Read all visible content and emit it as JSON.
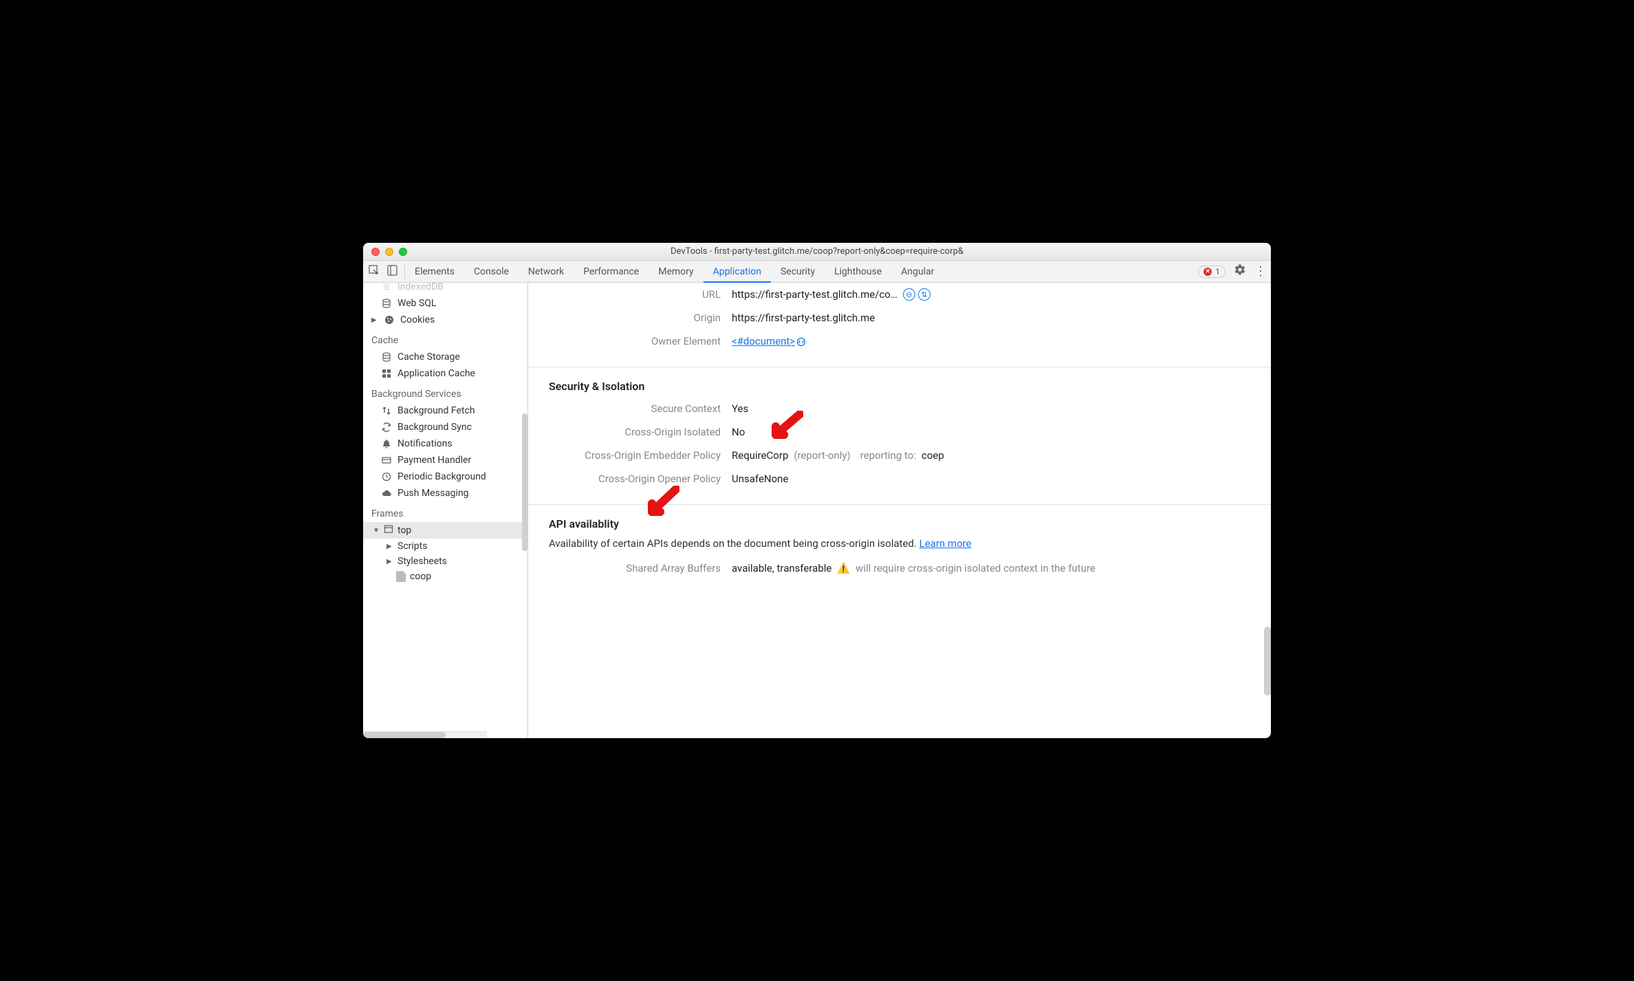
{
  "window": {
    "title": "DevTools - first-party-test.glitch.me/coop?report-only&coep=require-corp&"
  },
  "tabs": {
    "items": [
      "Elements",
      "Console",
      "Network",
      "Performance",
      "Memory",
      "Application",
      "Security",
      "Lighthouse",
      "Angular"
    ],
    "active": "Application",
    "error_count": "1"
  },
  "sidebar": {
    "indexeddb": "IndexedDB",
    "websql": "Web SQL",
    "cookies": "Cookies",
    "cache_label": "Cache",
    "cache_storage": "Cache Storage",
    "app_cache": "Application Cache",
    "bg_label": "Background Services",
    "bg_fetch": "Background Fetch",
    "bg_sync": "Background Sync",
    "notifications": "Notifications",
    "payment": "Payment Handler",
    "periodic": "Periodic Background",
    "push": "Push Messaging",
    "frames_label": "Frames",
    "top": "top",
    "scripts": "Scripts",
    "stylesheets": "Stylesheets",
    "coop_file": "coop"
  },
  "doc": {
    "url_label": "URL",
    "url_value": "https://first-party-test.glitch.me/co…",
    "origin_label": "Origin",
    "origin_value": "https://first-party-test.glitch.me",
    "owner_label": "Owner Element",
    "owner_value": "<#document>"
  },
  "sec": {
    "title": "Security & Isolation",
    "secure_ctx_label": "Secure Context",
    "secure_ctx_value": "Yes",
    "coi_label": "Cross-Origin Isolated",
    "coi_value": "No",
    "coep_label": "Cross-Origin Embedder Policy",
    "coep_value": "RequireCorp",
    "coep_flag": "(report-only)",
    "coep_report_label": "reporting to:",
    "coep_report_value": "coep",
    "coop_label": "Cross-Origin Opener Policy",
    "coop_value": "UnsafeNone"
  },
  "api": {
    "title": "API availablity",
    "desc": "Availability of certain APIs depends on the document being cross-origin isolated.",
    "learn_more": "Learn more",
    "sab_label": "Shared Array Buffers",
    "sab_value": "available, transferable",
    "sab_warn": "will require cross-origin isolated context in the future"
  }
}
